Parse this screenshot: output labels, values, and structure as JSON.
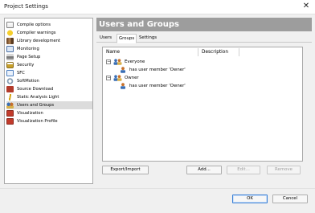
{
  "window": {
    "title": "Project Settings",
    "close_glyph": "✕"
  },
  "sidebar": {
    "items": [
      {
        "label": "Compile options",
        "icon": "compile-options-icon",
        "color": "#8a6d3b"
      },
      {
        "label": "Compiler warnings",
        "icon": "warning-icon",
        "color": "#e0a800"
      },
      {
        "label": "Library development",
        "icon": "library-icon",
        "color": "#7a5230"
      },
      {
        "label": "Monitoring",
        "icon": "monitoring-icon",
        "color": "#4a6fa5"
      },
      {
        "label": "Page Setup",
        "icon": "printer-icon",
        "color": "#6b6b6b"
      },
      {
        "label": "Security",
        "icon": "lock-icon",
        "color": "#c8a02a"
      },
      {
        "label": "SFC",
        "icon": "sfc-icon",
        "color": "#4d7fbf"
      },
      {
        "label": "SoftMotion",
        "icon": "softmotion-icon",
        "color": "#8aa0b6"
      },
      {
        "label": "Source Download",
        "icon": "download-icon",
        "color": "#b33b2b"
      },
      {
        "label": "Static Analysis Light",
        "icon": "static-analysis-icon",
        "color": "#d6a81a"
      },
      {
        "label": "Users and Groups",
        "icon": "users-groups-icon",
        "color": "#c7702a",
        "selected": true
      },
      {
        "label": "Visualization",
        "icon": "visualization-icon",
        "color": "#c23b2b"
      },
      {
        "label": "Visualization Profile",
        "icon": "visualization-profile-icon",
        "color": "#c23b2b"
      }
    ]
  },
  "main": {
    "title": "Users and Groups",
    "tabs": [
      {
        "label": "Users",
        "active": false
      },
      {
        "label": "Groups",
        "active": true
      },
      {
        "label": "Settings",
        "active": false
      }
    ],
    "columns": [
      "Name",
      "Description"
    ],
    "tree": [
      {
        "label": "Everyone",
        "type": "group",
        "expanded": true,
        "children": [
          {
            "label": "has user member 'Owner'",
            "type": "user"
          }
        ]
      },
      {
        "label": "Owner",
        "type": "group",
        "expanded": true,
        "children": [
          {
            "label": "has user member 'Owner'",
            "type": "user"
          }
        ]
      }
    ],
    "buttons": {
      "export_import": "Export/Import",
      "add": "Add...",
      "edit": "Edit...",
      "remove": "Remove"
    }
  },
  "footer": {
    "ok": "OK",
    "cancel": "Cancel"
  },
  "colors": {
    "header_bg": "#9d9d9d",
    "selection_bg": "#dcdcdc",
    "ok_border": "#3a7fd5"
  }
}
